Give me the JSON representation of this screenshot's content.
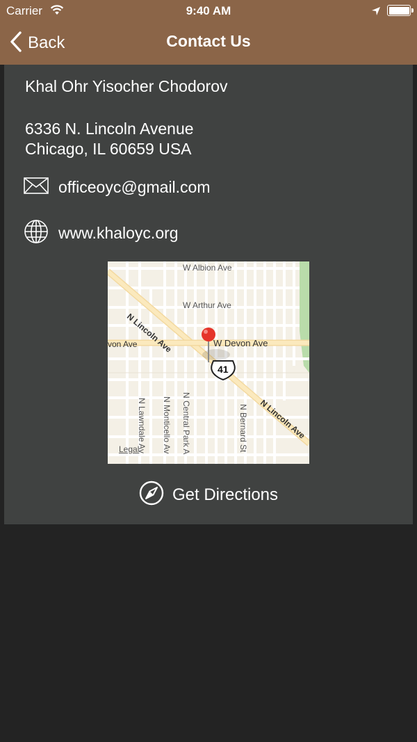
{
  "status_bar": {
    "carrier": "Carrier",
    "time": "9:40 AM"
  },
  "nav": {
    "back_label": "Back",
    "title": "Contact Us"
  },
  "contact": {
    "name": "Khal Ohr Yisocher Chodorov",
    "address_line1": "6336 N. Lincoln Avenue",
    "address_line2": "Chicago, IL 60659 USA",
    "email": "officeoyc@gmail.com",
    "website": "www.khaloyc.org"
  },
  "map": {
    "labels": {
      "albion": "W Albion Ave",
      "arthur": "W Arthur Ave",
      "devon_left": "von Ave",
      "devon_right": "W Devon Ave",
      "lincoln_top": "N Lincoln Ave",
      "lincoln_bottom": "N Lincoln Ave",
      "lawndale": "N Lawndale Av",
      "monticello": "N Monticello Av",
      "central_park": "N Central Park A",
      "bernard": "N Bernard St",
      "route": "41"
    },
    "legal": "Legal"
  },
  "directions": {
    "label": "Get Directions"
  },
  "colors": {
    "header": "#8b6548",
    "card": "#404241",
    "background": "#232323",
    "pin": "#e5342a"
  }
}
